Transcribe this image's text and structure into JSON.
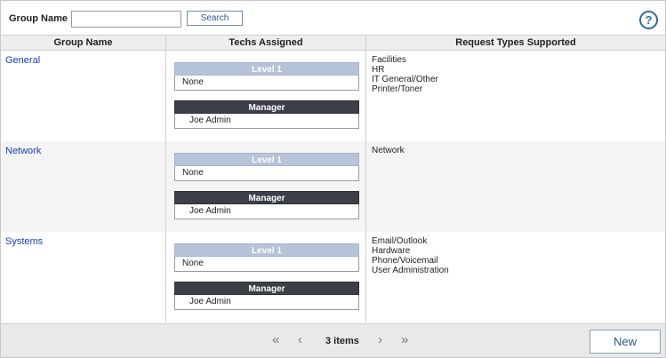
{
  "search": {
    "label": "Group Name",
    "value": "",
    "placeholder": "",
    "button": "Search"
  },
  "help_icon": "?",
  "columns": [
    "Group Name",
    "Techs Assigned",
    "Request Types Supported"
  ],
  "groups": [
    {
      "name": "General",
      "level_header": "Level 1",
      "level_value": "None",
      "manager_header": "Manager",
      "manager_value": "Joe Admin",
      "request_types": [
        "Facilities",
        "HR",
        "IT General/Other",
        "Printer/Toner"
      ]
    },
    {
      "name": "Network",
      "level_header": "Level 1",
      "level_value": "None",
      "manager_header": "Manager",
      "manager_value": "Joe Admin",
      "request_types": [
        "Network"
      ]
    },
    {
      "name": "Systems",
      "level_header": "Level 1",
      "level_value": "None",
      "manager_header": "Manager",
      "manager_value": "Joe Admin",
      "request_types": [
        "Email/Outlook",
        "Hardware",
        "Phone/Voicemail",
        "User Administration"
      ]
    }
  ],
  "pagination": {
    "first": "«",
    "prev": "‹",
    "items": "3 items",
    "next": "›",
    "last": "»"
  },
  "new_button": "New",
  "colors": {
    "link": "#1a3cc0",
    "level_header_bg": "#b7c3d8",
    "manager_header_bg": "#3c3f48",
    "accent": "#2a6aa0"
  }
}
